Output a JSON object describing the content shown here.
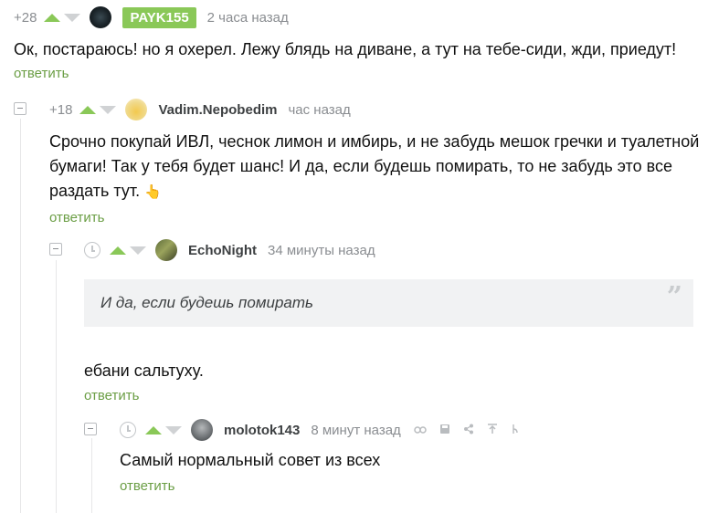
{
  "comments": [
    {
      "rating": "+28",
      "author": "PAYK155",
      "time": "2 часа назад",
      "text": "Ок, постараюсь! но я охерел. Лежу блядь на диване, а тут на тебе-сиди, жди, приедут!",
      "reply": "ответить"
    },
    {
      "rating": "+18",
      "author": "Vadim.Nepobedim",
      "time": "час назад",
      "text_line1": "Срочно покупай ИВЛ, чеснок лимон и имбирь, и не забудь мешок гречки и туалетной",
      "text_line2": "бумаги! Так у тебя будет шанс! И да, если будешь помирать, то не забудь это все",
      "text_line3": "раздать тут.",
      "emoji": "👆",
      "reply": "ответить"
    },
    {
      "author": "EchoNight",
      "time": "34 минуты назад",
      "quote": "И да, если будешь помирать",
      "quote_mark": "”",
      "text": "ебани сальтуху.",
      "reply": "ответить"
    },
    {
      "author": "molotok143",
      "time": "8 минут назад",
      "text": "Самый нормальный совет из всех",
      "reply": "ответить"
    }
  ],
  "icons": {
    "collapse": "minus-square-icon",
    "clock": "clock-icon",
    "link": "link-icon",
    "save": "save-icon",
    "share": "share-icon",
    "up": "scroll-to-parent-icon",
    "branch": "branch-icon"
  },
  "colors": {
    "accent": "#8ac858",
    "reply_link": "#6b9e45",
    "muted": "#8a8d91",
    "quote_bg": "#f1f2f3"
  }
}
